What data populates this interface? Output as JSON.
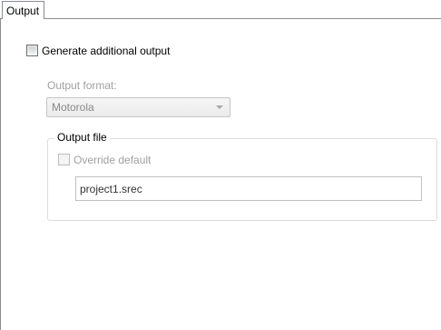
{
  "tabs": [
    {
      "label": "Output",
      "selected": true
    }
  ],
  "generate_additional_output": {
    "label": "Generate additional output",
    "checked": false
  },
  "output_format": {
    "label": "Output format:",
    "selected_value": "Motorola",
    "enabled": false
  },
  "output_file": {
    "group_label": "Output file",
    "override_default": {
      "label": "Override default",
      "checked": false,
      "enabled": false
    },
    "file_name": "project1.srec"
  },
  "colors": {
    "disabled_text": "#a0a0a0",
    "border": "#898c95"
  }
}
